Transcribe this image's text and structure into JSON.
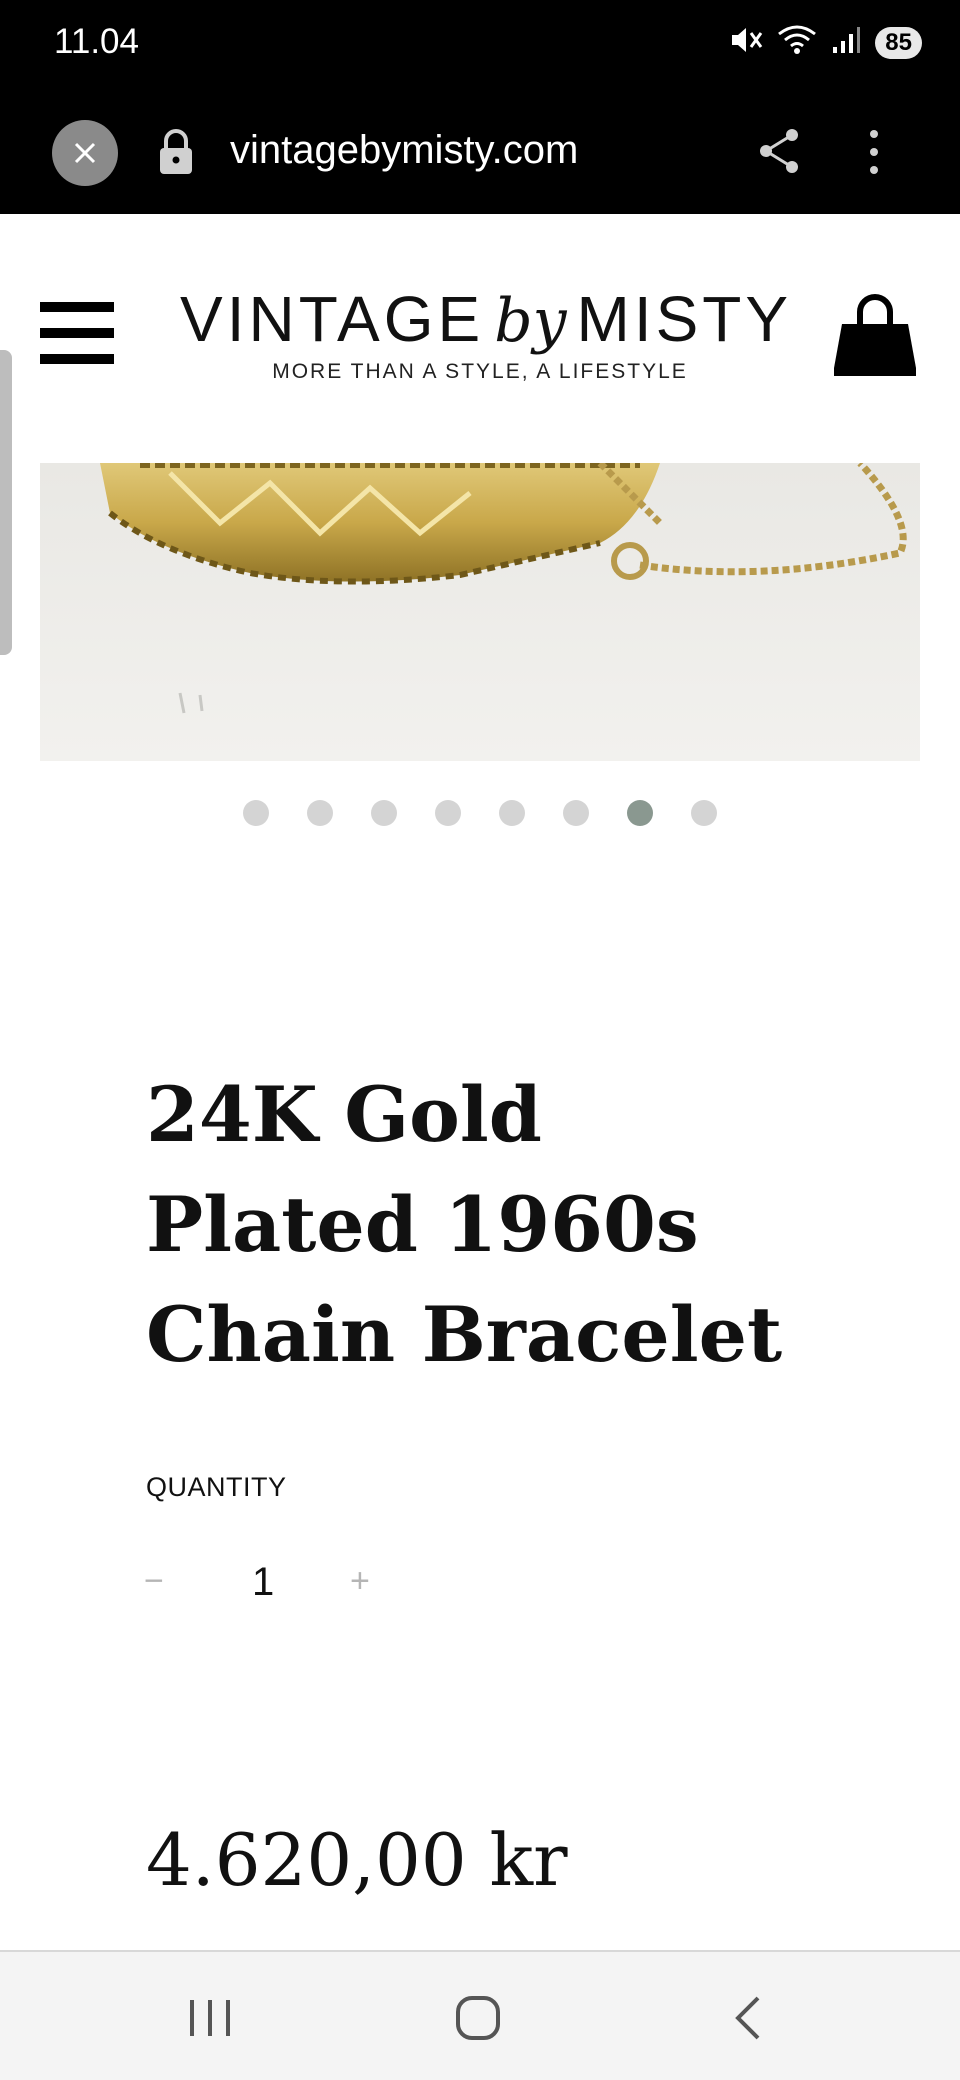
{
  "status_bar": {
    "time": "11.04",
    "battery": "85",
    "icons": [
      "mute-icon",
      "wifi-icon",
      "signal-icon",
      "battery-icon"
    ]
  },
  "browser": {
    "url": "vintagebymisty.com",
    "icons": [
      "close-icon",
      "lock-icon",
      "share-icon",
      "more-icon"
    ]
  },
  "header": {
    "logo_left": "VINTAGE",
    "logo_by": "by",
    "logo_right": "MISTY",
    "tagline": "MORE THAN A STYLE, A LIFESTYLE",
    "icons": [
      "menu-icon",
      "cart-bag-icon"
    ]
  },
  "gallery": {
    "dot_count": 8,
    "active_index": 6,
    "active_color": "#8a9890",
    "inactive_color": "#d4d4d4"
  },
  "product": {
    "title": "24K Gold Plated 1960s Chain Bracelet",
    "quantity_label": "QUANTITY",
    "minus": "−",
    "quantity": "1",
    "plus": "+",
    "price": "4.620,00 kr"
  },
  "nav_bar": {
    "icons": [
      "recents-icon",
      "home-icon",
      "back-icon"
    ]
  }
}
